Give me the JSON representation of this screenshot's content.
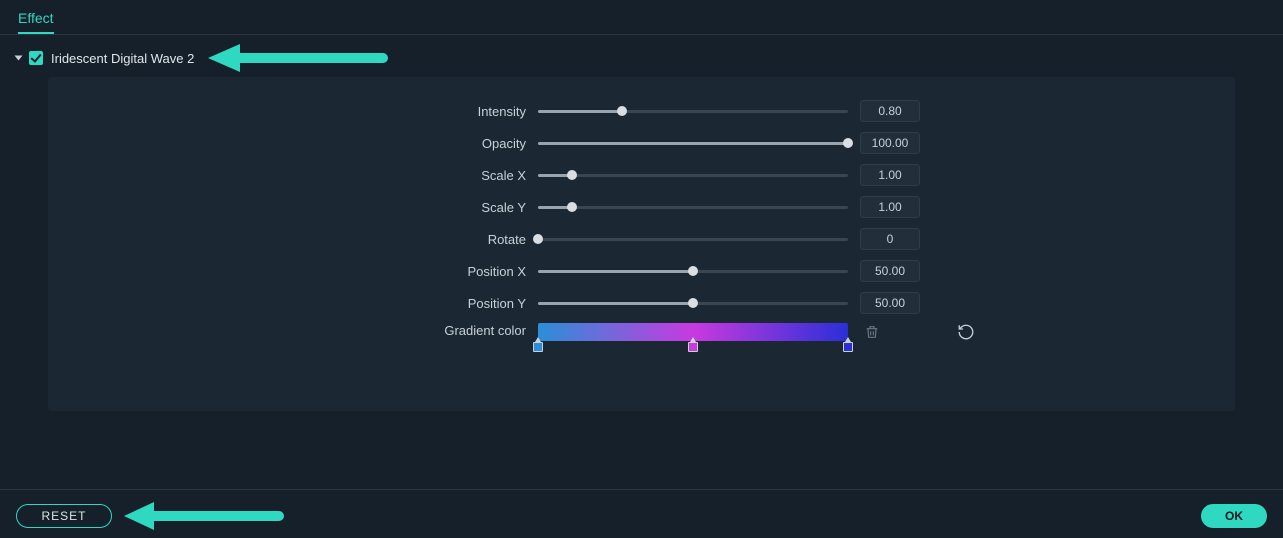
{
  "header": {
    "tab": "Effect"
  },
  "effect": {
    "expanded": true,
    "enabled": true,
    "name": "Iridescent Digital Wave 2"
  },
  "params": {
    "intensity": {
      "label": "Intensity",
      "value": "0.80",
      "pct": 27
    },
    "opacity": {
      "label": "Opacity",
      "value": "100.00",
      "pct": 100
    },
    "scalex": {
      "label": "Scale X",
      "value": "1.00",
      "pct": 11
    },
    "scaley": {
      "label": "Scale Y",
      "value": "1.00",
      "pct": 11
    },
    "rotate": {
      "label": "Rotate",
      "value": "0",
      "pct": 0
    },
    "posx": {
      "label": "Position X",
      "value": "50.00",
      "pct": 50
    },
    "posy": {
      "label": "Position Y",
      "value": "50.00",
      "pct": 50
    },
    "gradient_label": "Gradient color",
    "gradient_stops": [
      {
        "pos": 0,
        "color": "#2a8fd8"
      },
      {
        "pos": 50,
        "color": "#c83adf"
      },
      {
        "pos": 100,
        "color": "#2a2fd8"
      }
    ]
  },
  "footer": {
    "reset": "RESET",
    "ok": "OK"
  }
}
